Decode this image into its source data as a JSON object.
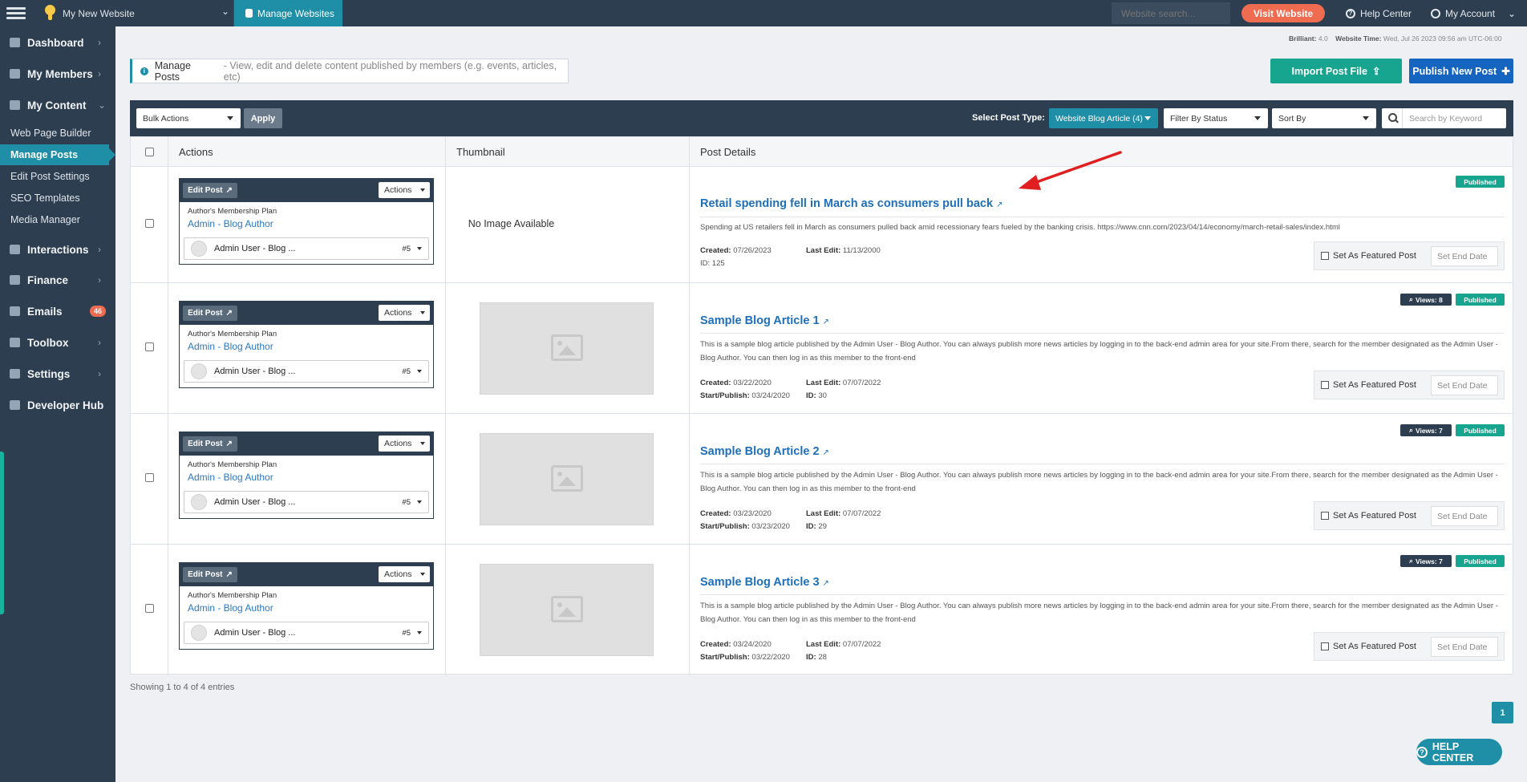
{
  "topbar": {
    "site_name": "My New Website",
    "manage_websites": "Manage Websites",
    "search_placeholder": "Website search...",
    "visit_website": "Visit Website",
    "help_center": "Help Center",
    "my_account": "My Account"
  },
  "sidebar": {
    "dashboard": "Dashboard",
    "my_members": "My Members",
    "my_content": "My Content",
    "sub": [
      "Web Page Builder",
      "Manage Posts",
      "Edit Post Settings",
      "SEO Templates",
      "Media Manager"
    ],
    "interactions": "Interactions",
    "finance": "Finance",
    "emails": "Emails",
    "emails_count": "46",
    "toolbox": "Toolbox",
    "settings": "Settings",
    "developer_hub": "Developer Hub"
  },
  "meta": {
    "brilliant_label": "Brilliant:",
    "brilliant_value": "4.0",
    "time_label": "Website Time:",
    "time_value": "Wed, Jul 26 2023 09:56 am UTC-06:00"
  },
  "notice": {
    "title": "Manage Posts",
    "desc": "- View, edit and delete content published by members (e.g. events, articles, etc)"
  },
  "buttons": {
    "import": "Import Post File",
    "publish": "Publish New Post"
  },
  "toolbar": {
    "bulk_actions": "Bulk Actions",
    "apply": "Apply",
    "select_post_type_label": "Select Post Type:",
    "post_type": "Website Blog Article (4)",
    "filter_status": "Filter By Status",
    "sort_by": "Sort By",
    "keyword_placeholder": "Search by Keyword"
  },
  "table": {
    "headers": {
      "actions": "Actions",
      "thumbnail": "Thumbnail",
      "details": "Post Details"
    },
    "edit_post": "Edit Post",
    "actions_btn": "Actions",
    "plan_label": "Author's Membership Plan",
    "plan_value": "Admin - Blog Author",
    "author_name": "Admin User - Blog ...",
    "author_num": "#5",
    "no_image": "No Image Available",
    "featured_label": "Set As Featured Post",
    "end_date_placeholder": "Set End Date",
    "created_label": "Created:",
    "last_edit_label": "Last Edit:",
    "start_label": "Start/Publish:",
    "id_label": "ID:",
    "published": "Published",
    "rows": [
      {
        "title": "Retail spending fell in March as consumers pull back",
        "desc": "Spending at US retailers fell in March as consumers pulled back amid recessionary fears fueled by the banking crisis. https://www.cnn.com/2023/04/14/economy/march-retail-sales/index.html",
        "created": "07/26/2023",
        "last_edit": "11/13/2000",
        "start": "",
        "id": "125",
        "views": ""
      },
      {
        "title": "Sample Blog Article 1",
        "desc": "This is a sample blog article published by the Admin User - Blog Author. You can always publish more news articles by logging in to the back-end admin area for your site.From there, search for the member designated as the Admin User - Blog Author. You can then log in as this member to the front-end",
        "created": "03/22/2020",
        "last_edit": "07/07/2022",
        "start": "03/24/2020",
        "id": "30",
        "views": "Views: 8"
      },
      {
        "title": "Sample Blog Article 2",
        "desc": "This is a sample blog article published by the Admin User - Blog Author. You can always publish more news articles by logging in to the back-end admin area for your site.From there, search for the member designated as the Admin User - Blog Author. You can then log in as this member to the front-end",
        "created": "03/23/2020",
        "last_edit": "07/07/2022",
        "start": "03/23/2020",
        "id": "29",
        "views": "Views: 7"
      },
      {
        "title": "Sample Blog Article 3",
        "desc": "This is a sample blog article published by the Admin User - Blog Author. You can always publish more news articles by logging in to the back-end admin area for your site.From there, search for the member designated as the Admin User - Blog Author. You can then log in as this member to the front-end",
        "created": "03/24/2020",
        "last_edit": "07/07/2022",
        "start": "03/22/2020",
        "id": "28",
        "views": "Views: 7"
      }
    ]
  },
  "footer": {
    "showing": "Showing 1 to 4 of 4 entries",
    "page": "1",
    "help_center": "HELP CENTER"
  },
  "colors": {
    "sidebar": "#2c3e50",
    "accent": "#1e8fa6",
    "visit": "#f06c51",
    "published": "#18a58f",
    "publish_btn": "#1565c0",
    "link": "#1e6fb8",
    "annotation_arrow": "#e02020"
  }
}
